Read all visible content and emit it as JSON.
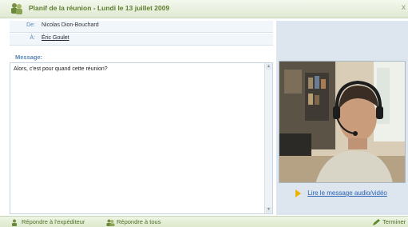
{
  "window": {
    "title": "Planif de la réunion - Lundi le 13 juillet 2009",
    "close_label": "x"
  },
  "header": {
    "from_label": "De:",
    "from_value": "Nicolas Dion-Bouchard",
    "to_label": "À:",
    "to_value": "Éric Goulet"
  },
  "message": {
    "label": "Message:",
    "body": "Alors, c'est pour quand cette réunion?"
  },
  "video": {
    "link_label": "Lire le message audio/vidéo"
  },
  "footer": {
    "reply_sender": "Répondre à l'expéditeur",
    "reply_all": "Répondre à tous",
    "finish": "Terminer"
  },
  "colors": {
    "accent_green": "#5d7d2e",
    "label_blue": "#5a87b3",
    "link_blue": "#2b63b5",
    "panel_bg": "#dde6ee"
  }
}
